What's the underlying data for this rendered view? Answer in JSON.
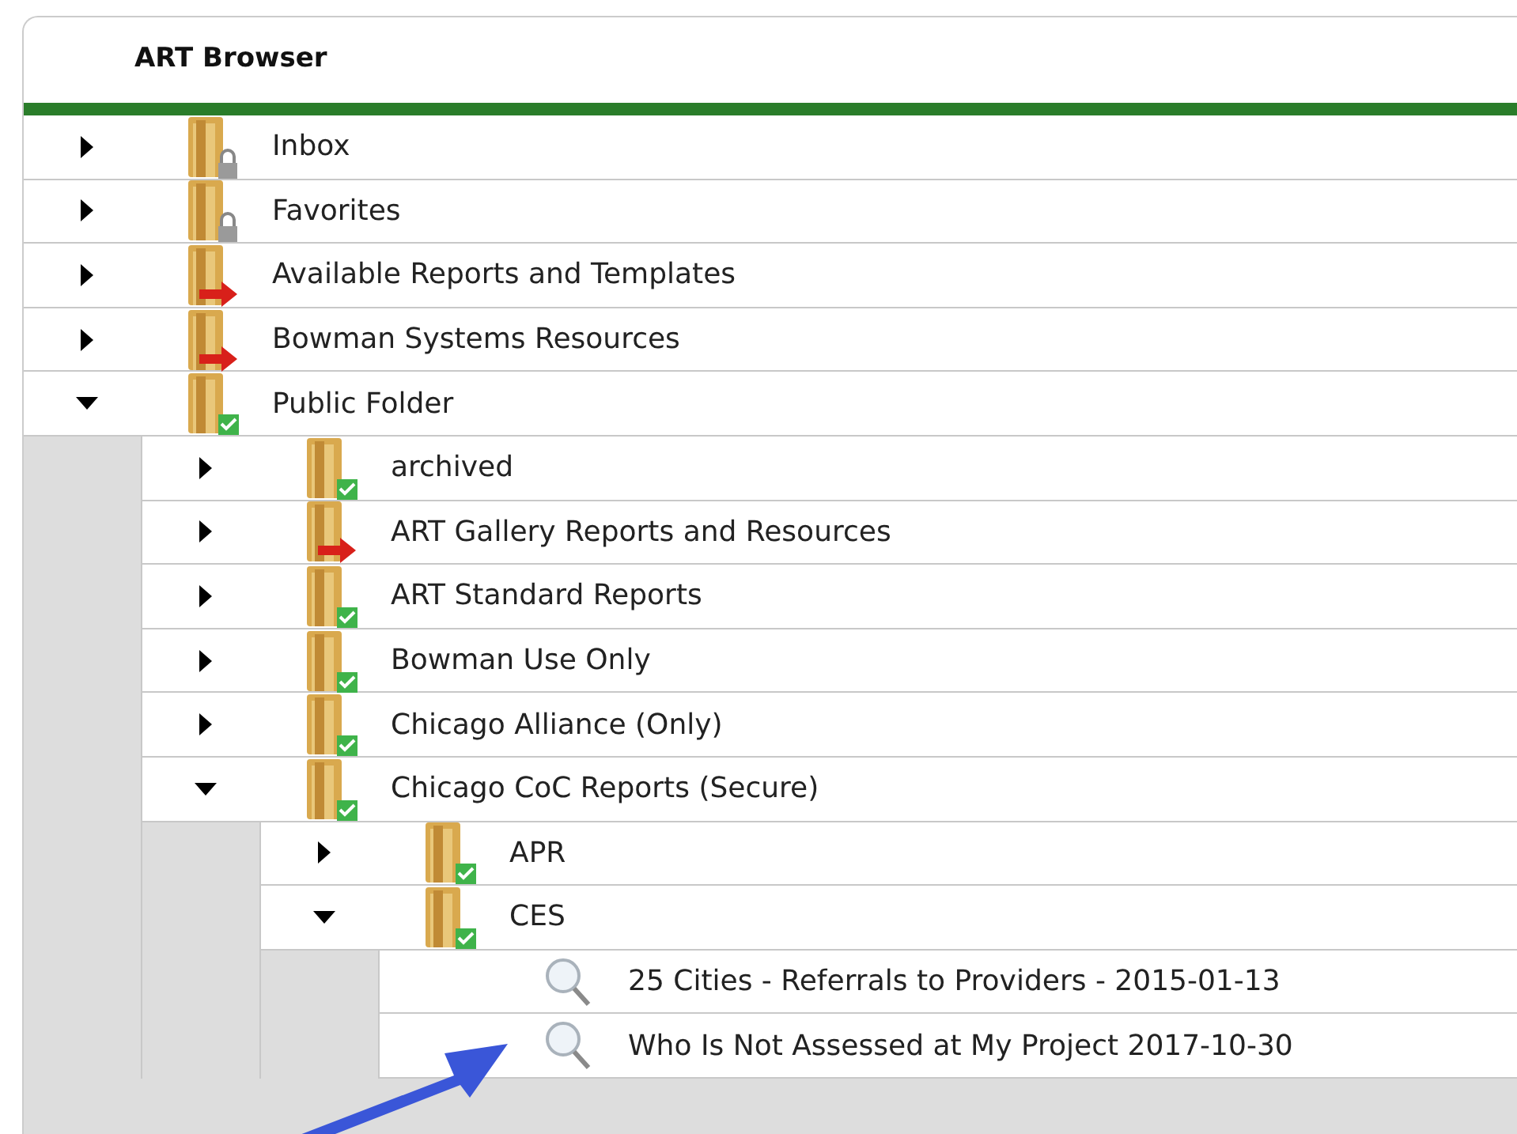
{
  "panel": {
    "title": "ART Browser"
  },
  "tree": [
    {
      "label": "Inbox",
      "kind": "locked",
      "expanded": false
    },
    {
      "label": "Favorites",
      "kind": "locked",
      "expanded": false
    },
    {
      "label": "Available Reports and Templates",
      "kind": "linked",
      "expanded": false
    },
    {
      "label": "Bowman Systems Resources",
      "kind": "linked",
      "expanded": false
    },
    {
      "label": "Public Folder",
      "kind": "shared",
      "expanded": true,
      "children": [
        {
          "label": "archived",
          "kind": "shared",
          "expanded": false
        },
        {
          "label": "ART Gallery Reports and Resources",
          "kind": "linked",
          "expanded": false
        },
        {
          "label": "ART Standard Reports",
          "kind": "shared",
          "expanded": false
        },
        {
          "label": "Bowman Use Only",
          "kind": "shared",
          "expanded": false
        },
        {
          "label": "Chicago Alliance (Only)",
          "kind": "shared",
          "expanded": false
        },
        {
          "label": "Chicago CoC Reports (Secure)",
          "kind": "shared",
          "expanded": true,
          "children": [
            {
              "label": "APR",
              "kind": "shared",
              "expanded": false
            },
            {
              "label": "CES",
              "kind": "shared",
              "expanded": true,
              "children": [
                {
                  "label": "25 Cities - Referrals to Providers - 2015-01-13",
                  "kind": "report"
                },
                {
                  "label": "Who Is Not Assessed at My Project 2017-10-30",
                  "kind": "report"
                }
              ]
            }
          ]
        }
      ]
    }
  ]
}
